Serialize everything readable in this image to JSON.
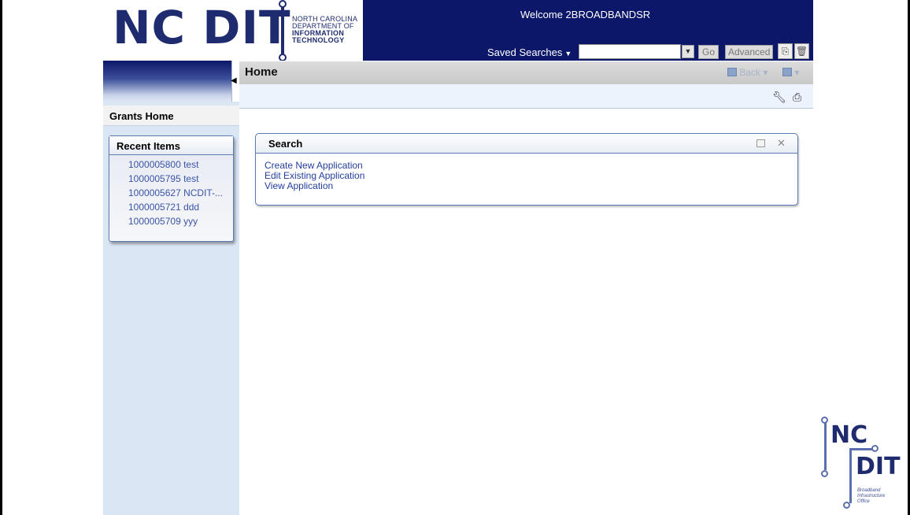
{
  "header": {
    "logo_main": "NC DIT",
    "logo_line1": "NORTH CAROLINA",
    "logo_line2": "DEPARTMENT OF",
    "logo_line3": "INFORMATION",
    "logo_line4": "TECHNOLOGY",
    "welcome": "Welcome 2BROADBANDSR",
    "saved_searches": "Saved Searches",
    "search_value": "",
    "go_label": "Go",
    "advanced_label": "Advanced"
  },
  "sidebar": {
    "grants_home": "Grants Home",
    "recent_title": "Recent Items",
    "recent_items": [
      "1000005800 test",
      "1000005795 test",
      "1000005627 NCDIT-...",
      "1000005721 ddd",
      "1000005709 yyy"
    ]
  },
  "main": {
    "title": "Home",
    "back_label": "Back",
    "panel": {
      "title": "Search",
      "links": [
        "Create New Application",
        "Edit Existing Application",
        "View Application"
      ]
    }
  },
  "footer_logo": {
    "nc": "NC",
    "dit": "DIT",
    "sub1": "Broadband",
    "sub2": "Infrastructure",
    "sub3": "Office"
  },
  "colors": {
    "brand_navy": "#0c1769",
    "link_blue": "#3a54a6",
    "sidebar_bg": "#dbe6f5"
  }
}
